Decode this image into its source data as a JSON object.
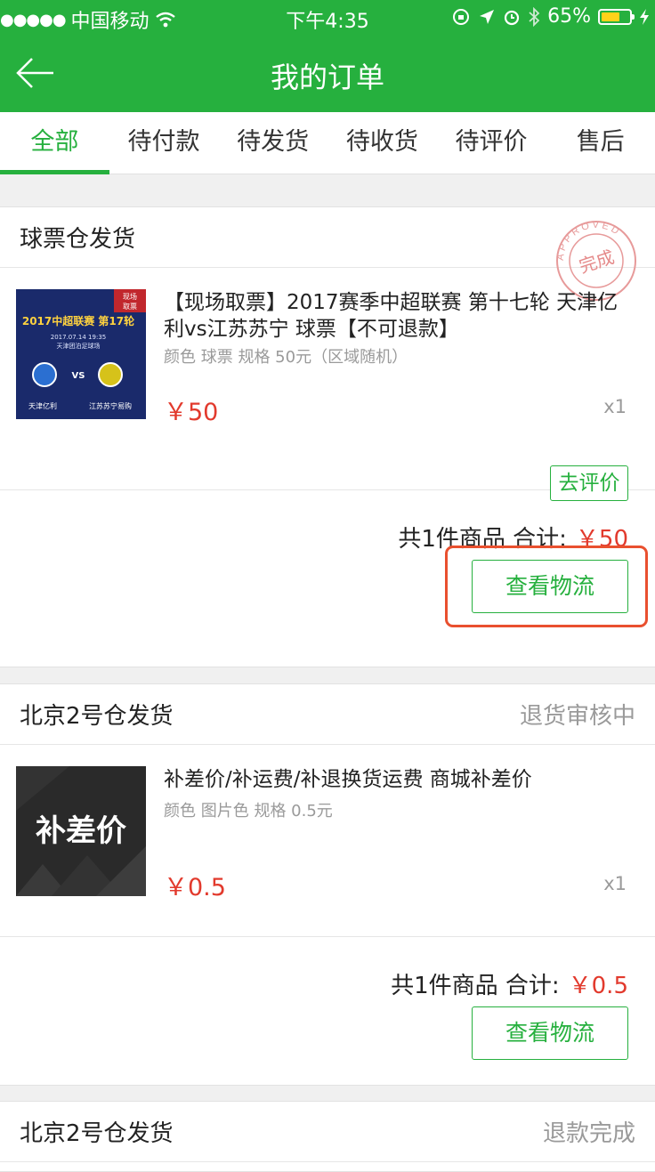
{
  "status_bar": {
    "signal": "●●●●●",
    "carrier": "中国移动",
    "time": "下午4:35",
    "battery": "65%",
    "battery_level": 0.65
  },
  "navbar": {
    "title": "我的订单"
  },
  "tabs": [
    {
      "label": "全部",
      "active": true
    },
    {
      "label": "待付款"
    },
    {
      "label": "待发货"
    },
    {
      "label": "待收货"
    },
    {
      "label": "待评价"
    },
    {
      "label": "售后"
    }
  ],
  "orders": [
    {
      "warehouse": "球票仓发货",
      "status": "",
      "stamp_text": "完成",
      "stamp_ring": "APPROVED",
      "item": {
        "title": "【现场取票】2017赛季中超联赛 第十七轮 天津亿利vs江苏苏宁 球票【不可退款】",
        "spec": "颜色 球票   规格 50元（区域随机）",
        "price": "￥50",
        "qty": "x1",
        "thumb": {
          "corner": "现场\n取票",
          "headline": "2017中超联赛 第17轮",
          "date": "2017.07.14 19:35",
          "venue": "天津团泊足球场",
          "vs": "VS",
          "team_left": "天津亿利",
          "team_right": "江苏苏宁易购"
        }
      },
      "review_button": "去评价",
      "summary": {
        "label": "共1件商品  合计:",
        "amount": "￥50"
      },
      "logistics_button": "查看物流"
    },
    {
      "warehouse": "北京2号仓发货",
      "status": "退货审核中",
      "item": {
        "title": "补差价/补运费/补退换货运费 商城补差价",
        "spec": "颜色 图片色   规格 0.5元",
        "price": "￥0.5",
        "qty": "x1",
        "thumb": {
          "text": "补差价"
        }
      },
      "summary": {
        "label": "共1件商品  合计:",
        "amount": "￥0.5"
      },
      "logistics_button": "查看物流"
    },
    {
      "warehouse": "北京2号仓发货",
      "status": "退款完成"
    }
  ],
  "colors": {
    "brand": "#26b03e",
    "price": "#e23a2d",
    "highlight": "#e9502f"
  }
}
